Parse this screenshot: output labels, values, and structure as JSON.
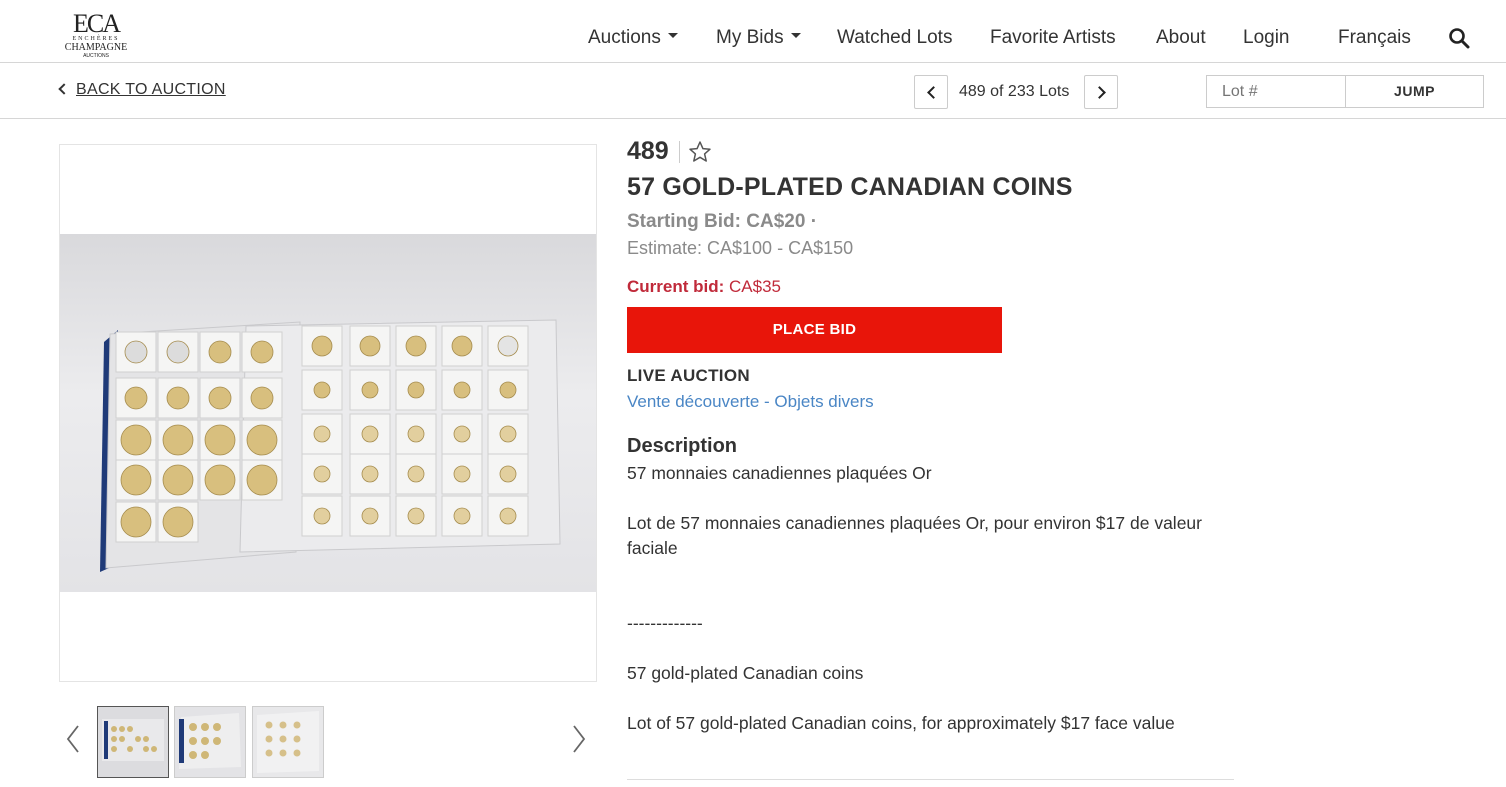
{
  "header": {
    "logo": {
      "mark": "ECA",
      "line1": "ENCHÈRES",
      "line2": "CHAMPAGNE",
      "line3": "AUCTIONS"
    },
    "nav": [
      {
        "label": "Auctions",
        "dropdown": true
      },
      {
        "label": "My Bids",
        "dropdown": true
      },
      {
        "label": "Watched Lots",
        "dropdown": false
      },
      {
        "label": "Favorite Artists",
        "dropdown": false
      },
      {
        "label": "About",
        "dropdown": false
      },
      {
        "label": "Login",
        "dropdown": false
      },
      {
        "label": "Français",
        "dropdown": false
      }
    ],
    "search_icon": "search-icon"
  },
  "subbar": {
    "back_label": "BACK TO AUCTION",
    "pagination_text": "489 of 233 Lots",
    "lot_input_placeholder": "Lot #",
    "jump_label": "JUMP"
  },
  "lot": {
    "number": "489",
    "title": "57 GOLD-PLATED CANADIAN COINS",
    "starting_bid": "Starting Bid: CA$20 ·",
    "estimate": "Estimate: CA$100 - CA$150",
    "current_bid_label": "Current bid:",
    "current_bid_value": "CA$35",
    "place_bid_label": "PLACE BID",
    "auction_type": "LIVE AUCTION",
    "sale_link": "Vente découverte - Objets divers",
    "description_heading": "Description",
    "description": [
      "57 monnaies canadiennes plaquées Or",
      "Lot de 57 monnaies canadiennes plaquées Or, pour environ $17 de valeur faciale",
      "-------------",
      "57 gold-plated Canadian coins",
      "Lot of 57 gold-plated Canadian coins, for approximately $17 face value"
    ]
  },
  "colors": {
    "place_bid": "#e8150a",
    "current_bid": "#c02a3a",
    "link": "#4a86c5",
    "muted": "#8a8a8a"
  },
  "gallery": {
    "thumbnail_count": 3,
    "active_index": 0
  }
}
